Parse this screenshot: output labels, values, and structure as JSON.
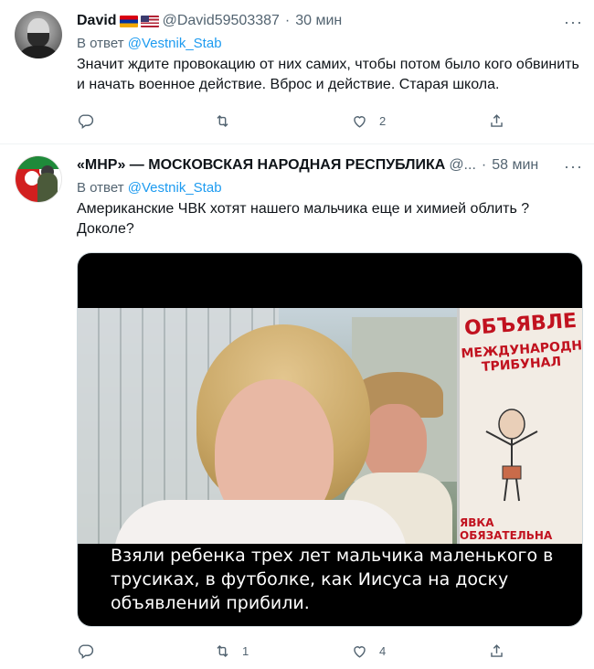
{
  "tweets": [
    {
      "name": "David",
      "handle": "@David59503387",
      "time": "30 мин",
      "replying_prefix": "В ответ",
      "replying_mention": "@Vestnik_Stab",
      "text": "Значит ждите провокацию от них самих, чтобы потом было кого обвинить и начать военное действие. Вброс и действие. Старая школа.",
      "reply_count": "",
      "retweet_count": "",
      "like_count": "2",
      "more": "···"
    },
    {
      "name": "«МНР» — МОСКОВСКАЯ НАРОДНАЯ РЕСПУБЛИКА",
      "handle": "@...",
      "time": "58 мин",
      "replying_prefix": "В ответ",
      "replying_mention": "@Vestnik_Stab",
      "text": "Американские ЧВК хотят нашего мальчика еще и химией облить ? Доколе?",
      "media": {
        "sign_title": "ОБЪЯВЛЕ",
        "sign_sub": "МЕЖДУНАРОДНЫЙ ТРИБУНАЛ",
        "sign_bottom": "ЯВКА ОБЯЗАТЕЛЬНА",
        "caption": "Взяли ребенка трех лет мальчика маленького в трусиках, в футболке, как Иисуса на доску объявлений прибили."
      },
      "reply_count": "",
      "retweet_count": "1",
      "like_count": "4",
      "more": "···"
    }
  ],
  "icons": {
    "reply": "reply-icon",
    "retweet": "retweet-icon",
    "like": "heart-icon",
    "share": "share-icon",
    "more": "more-icon"
  },
  "colors": {
    "link": "#1d9bf0",
    "secondary_text": "#536471",
    "divider": "#eff3f4"
  }
}
